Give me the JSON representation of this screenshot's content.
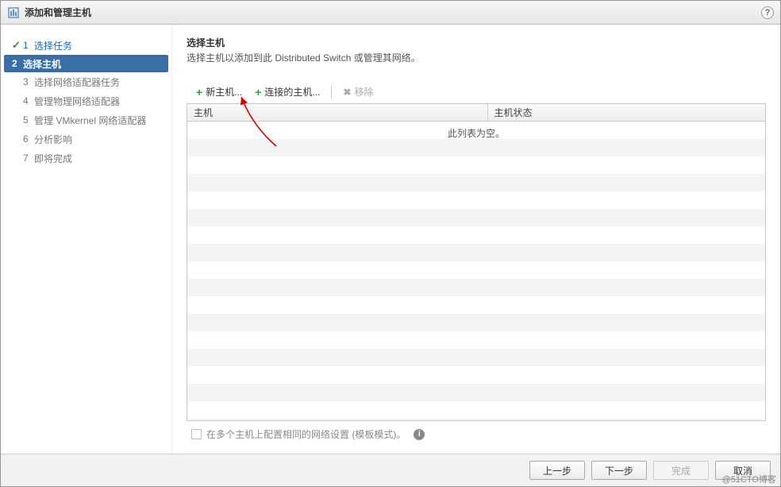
{
  "titlebar": {
    "title": "添加和管理主机",
    "help_tooltip": "?"
  },
  "sidebar": {
    "steps": [
      {
        "num": "1",
        "label": "选择任务",
        "state": "done"
      },
      {
        "num": "2",
        "label": "选择主机",
        "state": "active"
      },
      {
        "num": "3",
        "label": "选择网络适配器任务",
        "state": "future"
      },
      {
        "num": "4",
        "label": "管理物理网络适配器",
        "state": "future"
      },
      {
        "num": "5",
        "label": "管理 VMkernel 网络适配器",
        "state": "future"
      },
      {
        "num": "6",
        "label": "分析影响",
        "state": "future"
      },
      {
        "num": "7",
        "label": "即将完成",
        "state": "future"
      }
    ]
  },
  "main": {
    "heading": "选择主机",
    "subheading": "选择主机以添加到此 Distributed Switch 或管理其网络。",
    "toolbar": {
      "new_host_label": "新主机...",
      "attached_host_label": "连接的主机...",
      "remove_label": "移除"
    },
    "table": {
      "col_host": "主机",
      "col_status": "主机状态",
      "empty_message": "此列表为空。"
    },
    "template_checkbox_label": "在多个主机上配置相同的网络设置 (模板模式)。"
  },
  "footer": {
    "back": "上一步",
    "next": "下一步",
    "finish": "完成",
    "cancel": "取消"
  },
  "watermark": "@51CTO博客"
}
